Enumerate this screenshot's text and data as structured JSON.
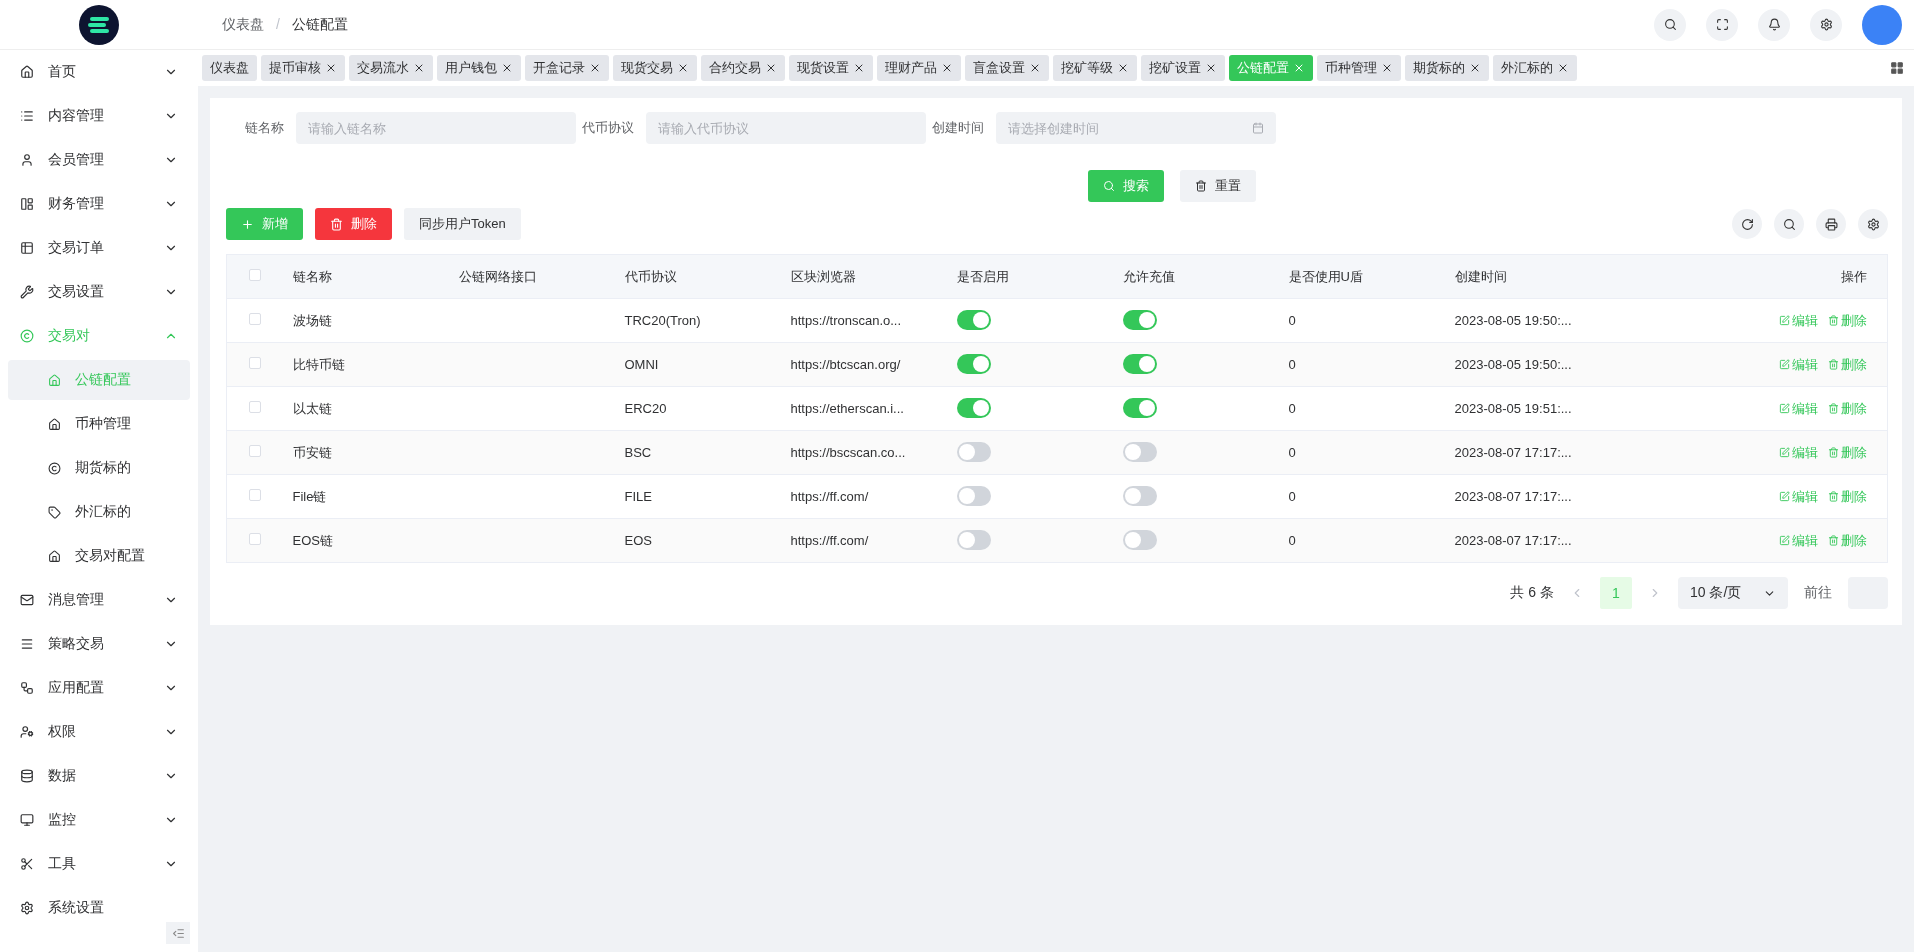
{
  "breadcrumb": [
    "仪表盘",
    "公链配置"
  ],
  "breadcrumb_separator": "/",
  "sidebar": {
    "items": [
      {
        "label": "首页",
        "expanded": false,
        "selected": false
      },
      {
        "label": "内容管理",
        "expanded": false,
        "selected": false
      },
      {
        "label": "会员管理",
        "expanded": false,
        "selected": false
      },
      {
        "label": "财务管理",
        "expanded": false,
        "selected": false
      },
      {
        "label": "交易订单",
        "expanded": false,
        "selected": false
      },
      {
        "label": "交易设置",
        "expanded": false,
        "selected": false
      },
      {
        "label": "交易对",
        "expanded": true,
        "selected": true,
        "children": [
          {
            "label": "公链配置",
            "selected": true
          },
          {
            "label": "币种管理",
            "selected": false
          },
          {
            "label": "期货标的",
            "selected": false
          },
          {
            "label": "外汇标的",
            "selected": false
          },
          {
            "label": "交易对配置",
            "selected": false
          }
        ]
      },
      {
        "label": "消息管理",
        "expanded": false,
        "selected": false
      },
      {
        "label": "策略交易",
        "expanded": false,
        "selected": false
      },
      {
        "label": "应用配置",
        "expanded": false,
        "selected": false
      },
      {
        "label": "权限",
        "expanded": false,
        "selected": false
      },
      {
        "label": "数据",
        "expanded": false,
        "selected": false
      },
      {
        "label": "监控",
        "expanded": false,
        "selected": false
      },
      {
        "label": "工具",
        "expanded": false,
        "selected": false
      },
      {
        "label": "系统设置",
        "selected": false
      }
    ]
  },
  "tabs": [
    {
      "label": "仪表盘",
      "closable": false,
      "selected": false
    },
    {
      "label": "提币审核",
      "closable": true,
      "selected": false
    },
    {
      "label": "交易流水",
      "closable": true,
      "selected": false
    },
    {
      "label": "用户钱包",
      "closable": true,
      "selected": false
    },
    {
      "label": "开盒记录",
      "closable": true,
      "selected": false
    },
    {
      "label": "现货交易",
      "closable": true,
      "selected": false
    },
    {
      "label": "合约交易",
      "closable": true,
      "selected": false
    },
    {
      "label": "现货设置",
      "closable": true,
      "selected": false
    },
    {
      "label": "理财产品",
      "closable": true,
      "selected": false
    },
    {
      "label": "盲盒设置",
      "closable": true,
      "selected": false
    },
    {
      "label": "挖矿等级",
      "closable": true,
      "selected": false
    },
    {
      "label": "挖矿设置",
      "closable": true,
      "selected": false
    },
    {
      "label": "公链配置",
      "closable": true,
      "selected": true
    },
    {
      "label": "币种管理",
      "closable": true,
      "selected": false
    },
    {
      "label": "期货标的",
      "closable": true,
      "selected": false
    },
    {
      "label": "外汇标的",
      "closable": true,
      "selected": false
    }
  ],
  "filters": [
    {
      "label": "链名称",
      "placeholder": "请输入链名称",
      "kind": "text"
    },
    {
      "label": "代币协议",
      "placeholder": "请输入代币协议",
      "kind": "text"
    },
    {
      "label": "创建时间",
      "placeholder": "请选择创建时间",
      "kind": "date"
    }
  ],
  "search_button": "搜索",
  "reset_button": "重置",
  "toolbar": [
    {
      "label": "新增",
      "kind": "add"
    },
    {
      "label": "删除",
      "kind": "delete"
    },
    {
      "label": "同步用户Token",
      "kind": "plain"
    }
  ],
  "table": {
    "columns": [
      "链名称",
      "公链网络接口",
      "代币协议",
      "区块浏览器",
      "是否启用",
      "允许充值",
      "是否使用U盾",
      "创建时间",
      "操作"
    ],
    "header_checked": false,
    "rows": [
      {
        "checked": false,
        "name": "波场链",
        "protocol": "TRC20(Tron)",
        "explorer": "https://tronscan.o...",
        "enabled": true,
        "deposit": true,
        "ushield": "0",
        "created": "2023-08-05 19:50:...",
        "actions": [
          "编辑",
          "删除"
        ]
      },
      {
        "checked": false,
        "name": "比特币链",
        "protocol": "OMNI",
        "explorer": "https://btcscan.org/",
        "enabled": true,
        "deposit": true,
        "ushield": "0",
        "created": "2023-08-05 19:50:...",
        "actions": [
          "编辑",
          "删除"
        ]
      },
      {
        "checked": false,
        "name": "以太链",
        "protocol": "ERC20",
        "explorer": "https://etherscan.i...",
        "enabled": true,
        "deposit": true,
        "ushield": "0",
        "created": "2023-08-05 19:51:...",
        "actions": [
          "编辑",
          "删除"
        ]
      },
      {
        "checked": false,
        "name": "币安链",
        "protocol": "BSC",
        "explorer": "https://bscscan.co...",
        "enabled": false,
        "deposit": false,
        "ushield": "0",
        "created": "2023-08-07 17:17:...",
        "actions": [
          "编辑",
          "删除"
        ]
      },
      {
        "checked": false,
        "name": "File链",
        "protocol": "FILE",
        "explorer": "https://ff.com/",
        "enabled": false,
        "deposit": false,
        "ushield": "0",
        "created": "2023-08-07 17:17:...",
        "actions": [
          "编辑",
          "删除"
        ]
      },
      {
        "checked": false,
        "name": "EOS链",
        "protocol": "EOS",
        "explorer": "https://ff.com/",
        "enabled": false,
        "deposit": false,
        "ushield": "0",
        "created": "2023-08-07 17:17:...",
        "actions": [
          "编辑",
          "删除"
        ]
      }
    ]
  },
  "pagination": {
    "total": "共 6 条",
    "pages": [
      {
        "label": "1",
        "selected": true
      }
    ],
    "page_size": "10 条/页",
    "goto": "前往"
  }
}
